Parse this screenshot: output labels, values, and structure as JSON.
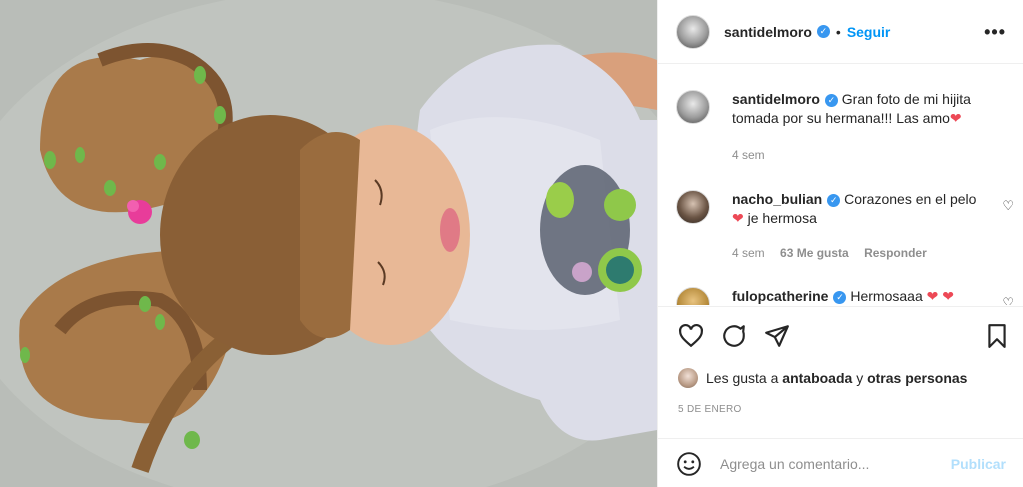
{
  "post": {
    "username": "santidelmoro",
    "follow_label": "Seguir",
    "dot": "•",
    "more_label": "•••"
  },
  "comments": [
    {
      "username": "santidelmoro",
      "text": "Gran foto de mi hijita tomada por su hermana!!! Las amo",
      "emoji": "❤",
      "time": "4 sem"
    },
    {
      "username": "nacho_bulian",
      "text_before": "Corazones en el pelo",
      "emoji": "❤",
      "text_after": "je hermosa",
      "time": "4 sem",
      "likes": "63 Me gusta",
      "reply": "Responder"
    },
    {
      "username": "fulopcatherine",
      "text": "Hermosaaa",
      "emoji": "❤ ❤"
    }
  ],
  "likes": {
    "prefix": "Les gusta a",
    "user": "antaboada",
    "connector": "y",
    "others": "otras personas"
  },
  "date": "5 DE ENERO",
  "composer": {
    "placeholder": "Agrega un comentario...",
    "publish_label": "Publicar"
  },
  "colors": {
    "accent": "#0095f6",
    "verified": "#3897f0",
    "heart": "#ed4956",
    "muted": "#8e8e8e",
    "publish_disabled": "#b2dffc"
  }
}
